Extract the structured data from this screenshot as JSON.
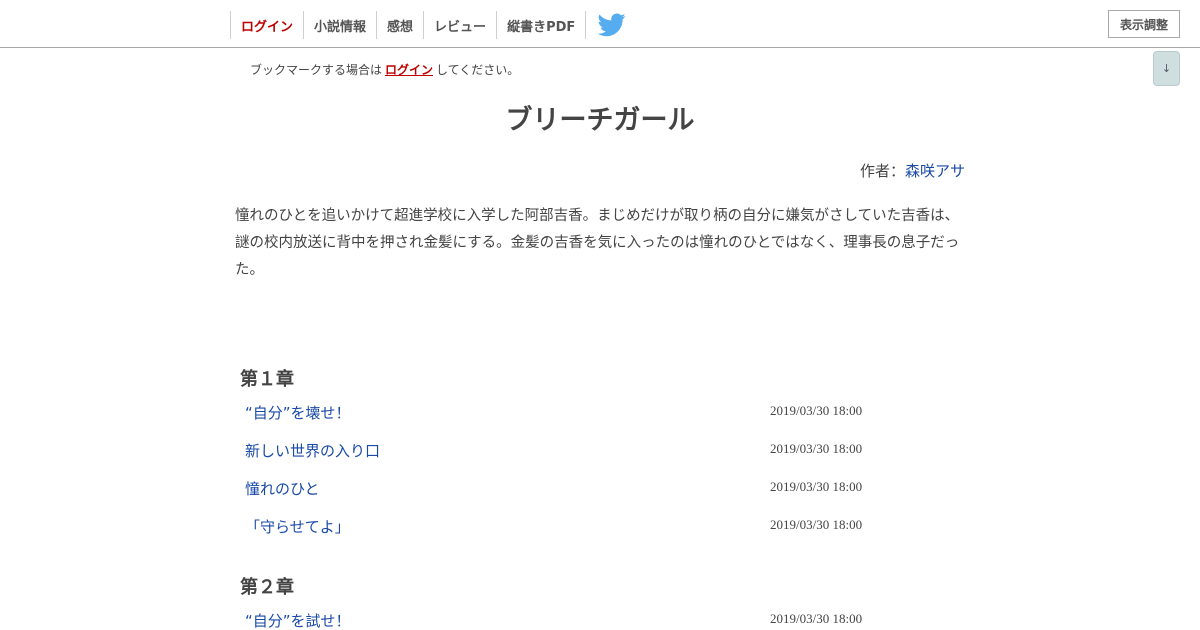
{
  "nav": {
    "items": [
      {
        "label": "ログイン",
        "active": true
      },
      {
        "label": "小説情報",
        "active": false
      },
      {
        "label": "感想",
        "active": false
      },
      {
        "label": "レビュー",
        "active": false
      },
      {
        "label": "縦書きPDF",
        "active": false
      }
    ],
    "twitter_icon": "twitter-bird-icon",
    "display_settings": "表示調整",
    "scroll_down": "↓"
  },
  "bookmark": {
    "before": "ブックマークする場合は",
    "link": "ログイン",
    "after": "してください。"
  },
  "novel": {
    "title": "ブリーチガール",
    "author_prefix": "作者：",
    "author": "森咲アサ",
    "synopsis": "憧れのひとを追いかけて超進学校に入学した阿部吉香。まじめだけが取り柄の自分に嫌気がさしていた吉香は、謎の校内放送に背中を押され金髪にする。金髪の吉香を気に入ったのは憧れのひとではなく、理事長の息子だった。"
  },
  "chapters": [
    {
      "title": "第１章",
      "episodes": [
        {
          "title": "“自分”を壊せ！",
          "date": "2019/03/30 18:00"
        },
        {
          "title": "新しい世界の入り口",
          "date": "2019/03/30 18:00"
        },
        {
          "title": "憧れのひと",
          "date": "2019/03/30 18:00"
        },
        {
          "title": "「守らせてよ」",
          "date": "2019/03/30 18:00"
        }
      ]
    },
    {
      "title": "第２章",
      "episodes": [
        {
          "title": "“自分”を試せ！",
          "date": "2019/03/30 18:00"
        }
      ]
    }
  ],
  "colors": {
    "accent_red": "#c00000",
    "link_blue": "#1a4aa8",
    "twitter_blue": "#55acee"
  }
}
